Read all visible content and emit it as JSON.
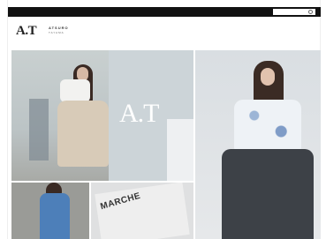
{
  "utility_bar": {
    "items": [
      "",
      "",
      "",
      "",
      "",
      "",
      ""
    ]
  },
  "header": {
    "logo": "A.T",
    "brand_line1": "ATSURO",
    "brand_line2": "TAYAMA"
  },
  "nav": {
    "items": [
      "",
      "",
      "",
      "",
      "",
      ""
    ],
    "sub_label": ""
  },
  "hero": {
    "logo_text": "A.T"
  },
  "tiles": {
    "second_text": "MARCHE"
  },
  "colors": {
    "topbar": "#111111",
    "accent": "#b9121b"
  }
}
